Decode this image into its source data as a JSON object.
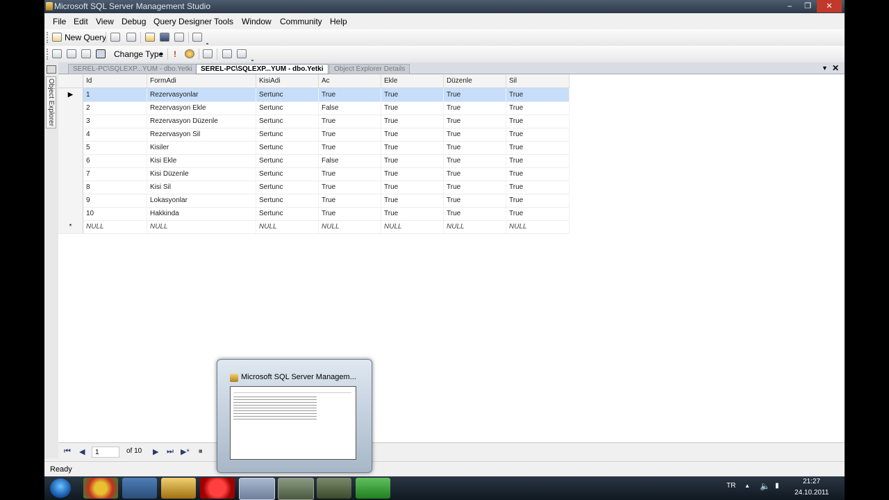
{
  "window": {
    "title": "Microsoft SQL Server Management Studio"
  },
  "menu": [
    "File",
    "Edit",
    "View",
    "Debug",
    "Query Designer",
    "Tools",
    "Window",
    "Community",
    "Help"
  ],
  "toolbar": {
    "new_query": "New Query",
    "change_type": "Change Type"
  },
  "object_explorer": {
    "label": "Object Explorer"
  },
  "tabs": [
    {
      "label": "SEREL-PC\\SQLEXP...YUM - dbo.Yetki",
      "active": false
    },
    {
      "label": "SEREL-PC\\SQLEXP...YUM - dbo.Yetki",
      "active": true
    },
    {
      "label": "Object Explorer Details",
      "active": false
    }
  ],
  "grid": {
    "columns": [
      "Id",
      "FormAdi",
      "KisiAdi",
      "Ac",
      "Ekle",
      "Düzenle",
      "Sil"
    ],
    "rows": [
      [
        "1",
        "Rezervasyonlar",
        "Sertunc",
        "True",
        "True",
        "True",
        "True"
      ],
      [
        "2",
        "Rezervasyon Ekle",
        "Sertunc",
        "False",
        "True",
        "True",
        "True"
      ],
      [
        "3",
        "Rezervasyon Düzenle",
        "Sertunc",
        "True",
        "True",
        "True",
        "True"
      ],
      [
        "4",
        "Rezervasyon Sil",
        "Sertunc",
        "True",
        "True",
        "True",
        "True"
      ],
      [
        "5",
        "Kisiler",
        "Sertunc",
        "True",
        "True",
        "True",
        "True"
      ],
      [
        "6",
        "Kisi Ekle",
        "Sertunc",
        "False",
        "True",
        "True",
        "True"
      ],
      [
        "7",
        "Kisi Düzenle",
        "Sertunc",
        "True",
        "True",
        "True",
        "True"
      ],
      [
        "8",
        "Kisi Sil",
        "Sertunc",
        "True",
        "True",
        "True",
        "True"
      ],
      [
        "9",
        "Lokasyonlar",
        "Sertunc",
        "True",
        "True",
        "True",
        "True"
      ],
      [
        "10",
        "Hakkinda",
        "Sertunc",
        "True",
        "True",
        "True",
        "True"
      ]
    ],
    "new_row": [
      "NULL",
      "NULL",
      "NULL",
      "NULL",
      "NULL",
      "NULL",
      "NULL"
    ],
    "selected_row": 1
  },
  "navigation": {
    "current_page": "1",
    "of_label": "of 10"
  },
  "status": {
    "text": "Ready"
  },
  "taskbar": {
    "preview_title": "Microsoft SQL Server Managem...",
    "lang": "TR",
    "time": "21:27",
    "date": "24.10.2011"
  },
  "colors": {
    "selected_row": "#c6defa",
    "taskbar": "#1a2430"
  }
}
